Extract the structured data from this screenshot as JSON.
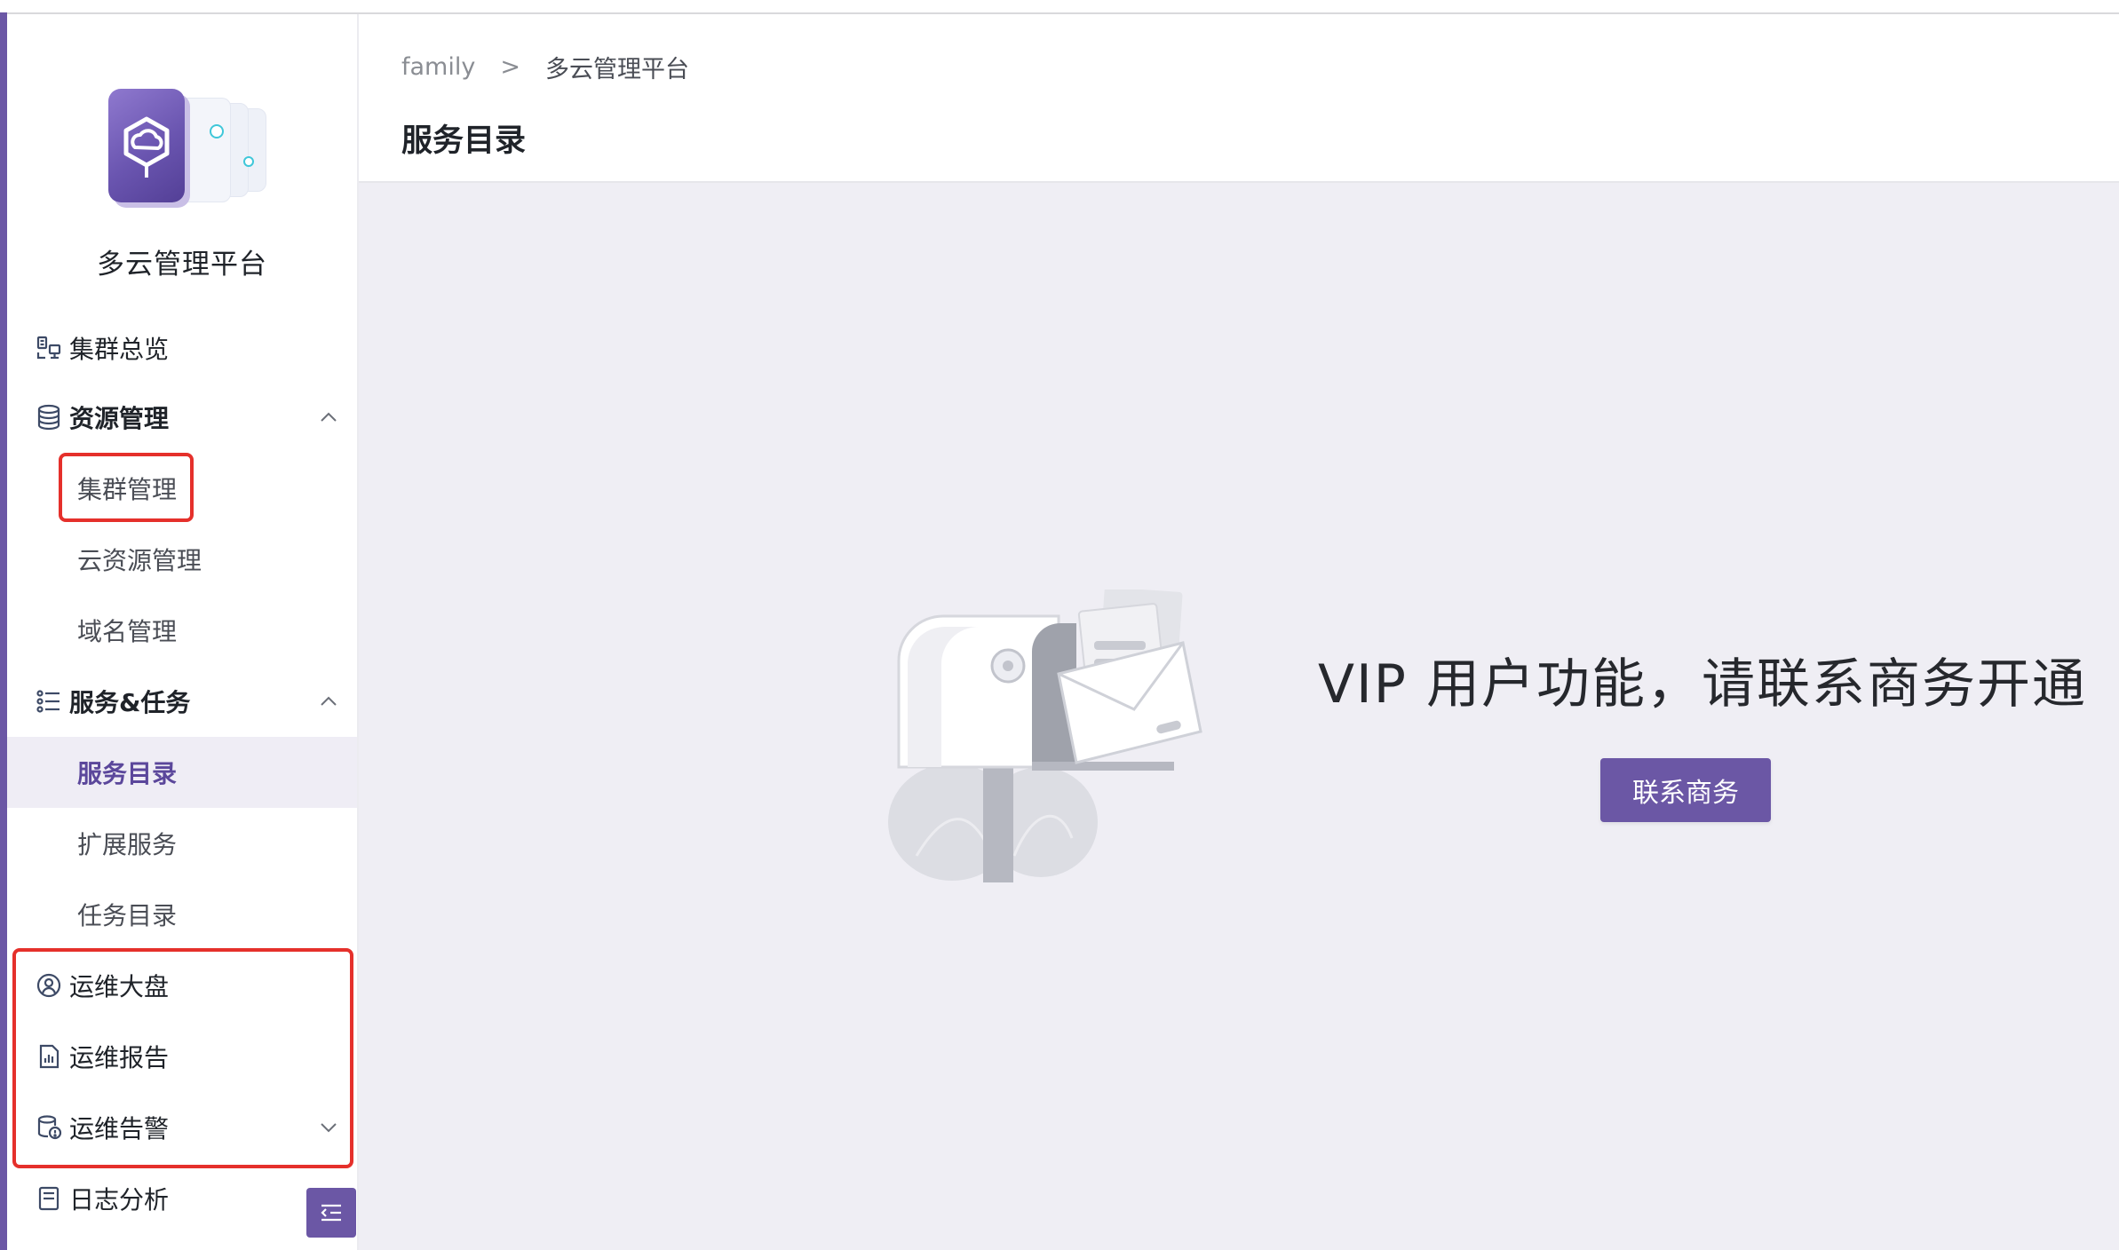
{
  "app": {
    "name": "多云管理平台"
  },
  "breadcrumb": {
    "root": "family",
    "separator": ">",
    "current": "多云管理平台"
  },
  "page": {
    "title": "服务目录"
  },
  "sidebar": {
    "items": [
      {
        "label": "集群总览",
        "icon": "cluster-overview-icon"
      },
      {
        "label": "资源管理",
        "icon": "database-icon",
        "expanded": true
      },
      {
        "label": "集群管理",
        "highlighted": true
      },
      {
        "label": "云资源管理"
      },
      {
        "label": "域名管理"
      },
      {
        "label": "服务&任务",
        "icon": "list-icon",
        "expanded": true
      },
      {
        "label": "服务目录",
        "active": true
      },
      {
        "label": "扩展服务"
      },
      {
        "label": "任务目录"
      },
      {
        "label": "运维大盘",
        "icon": "dashboard-icon",
        "highlighted": true
      },
      {
        "label": "运维报告",
        "icon": "report-icon",
        "highlighted": true
      },
      {
        "label": "运维告警",
        "icon": "alert-icon",
        "highlighted": true,
        "expanded": false
      },
      {
        "label": "日志分析",
        "icon": "log-icon"
      }
    ]
  },
  "main": {
    "message": "VIP 用户功能，请联系商务开通",
    "button_label": "联系商务"
  },
  "colors": {
    "accent": "#6b57a5",
    "highlight_box": "#e5302b",
    "content_bg": "#efeef4"
  }
}
